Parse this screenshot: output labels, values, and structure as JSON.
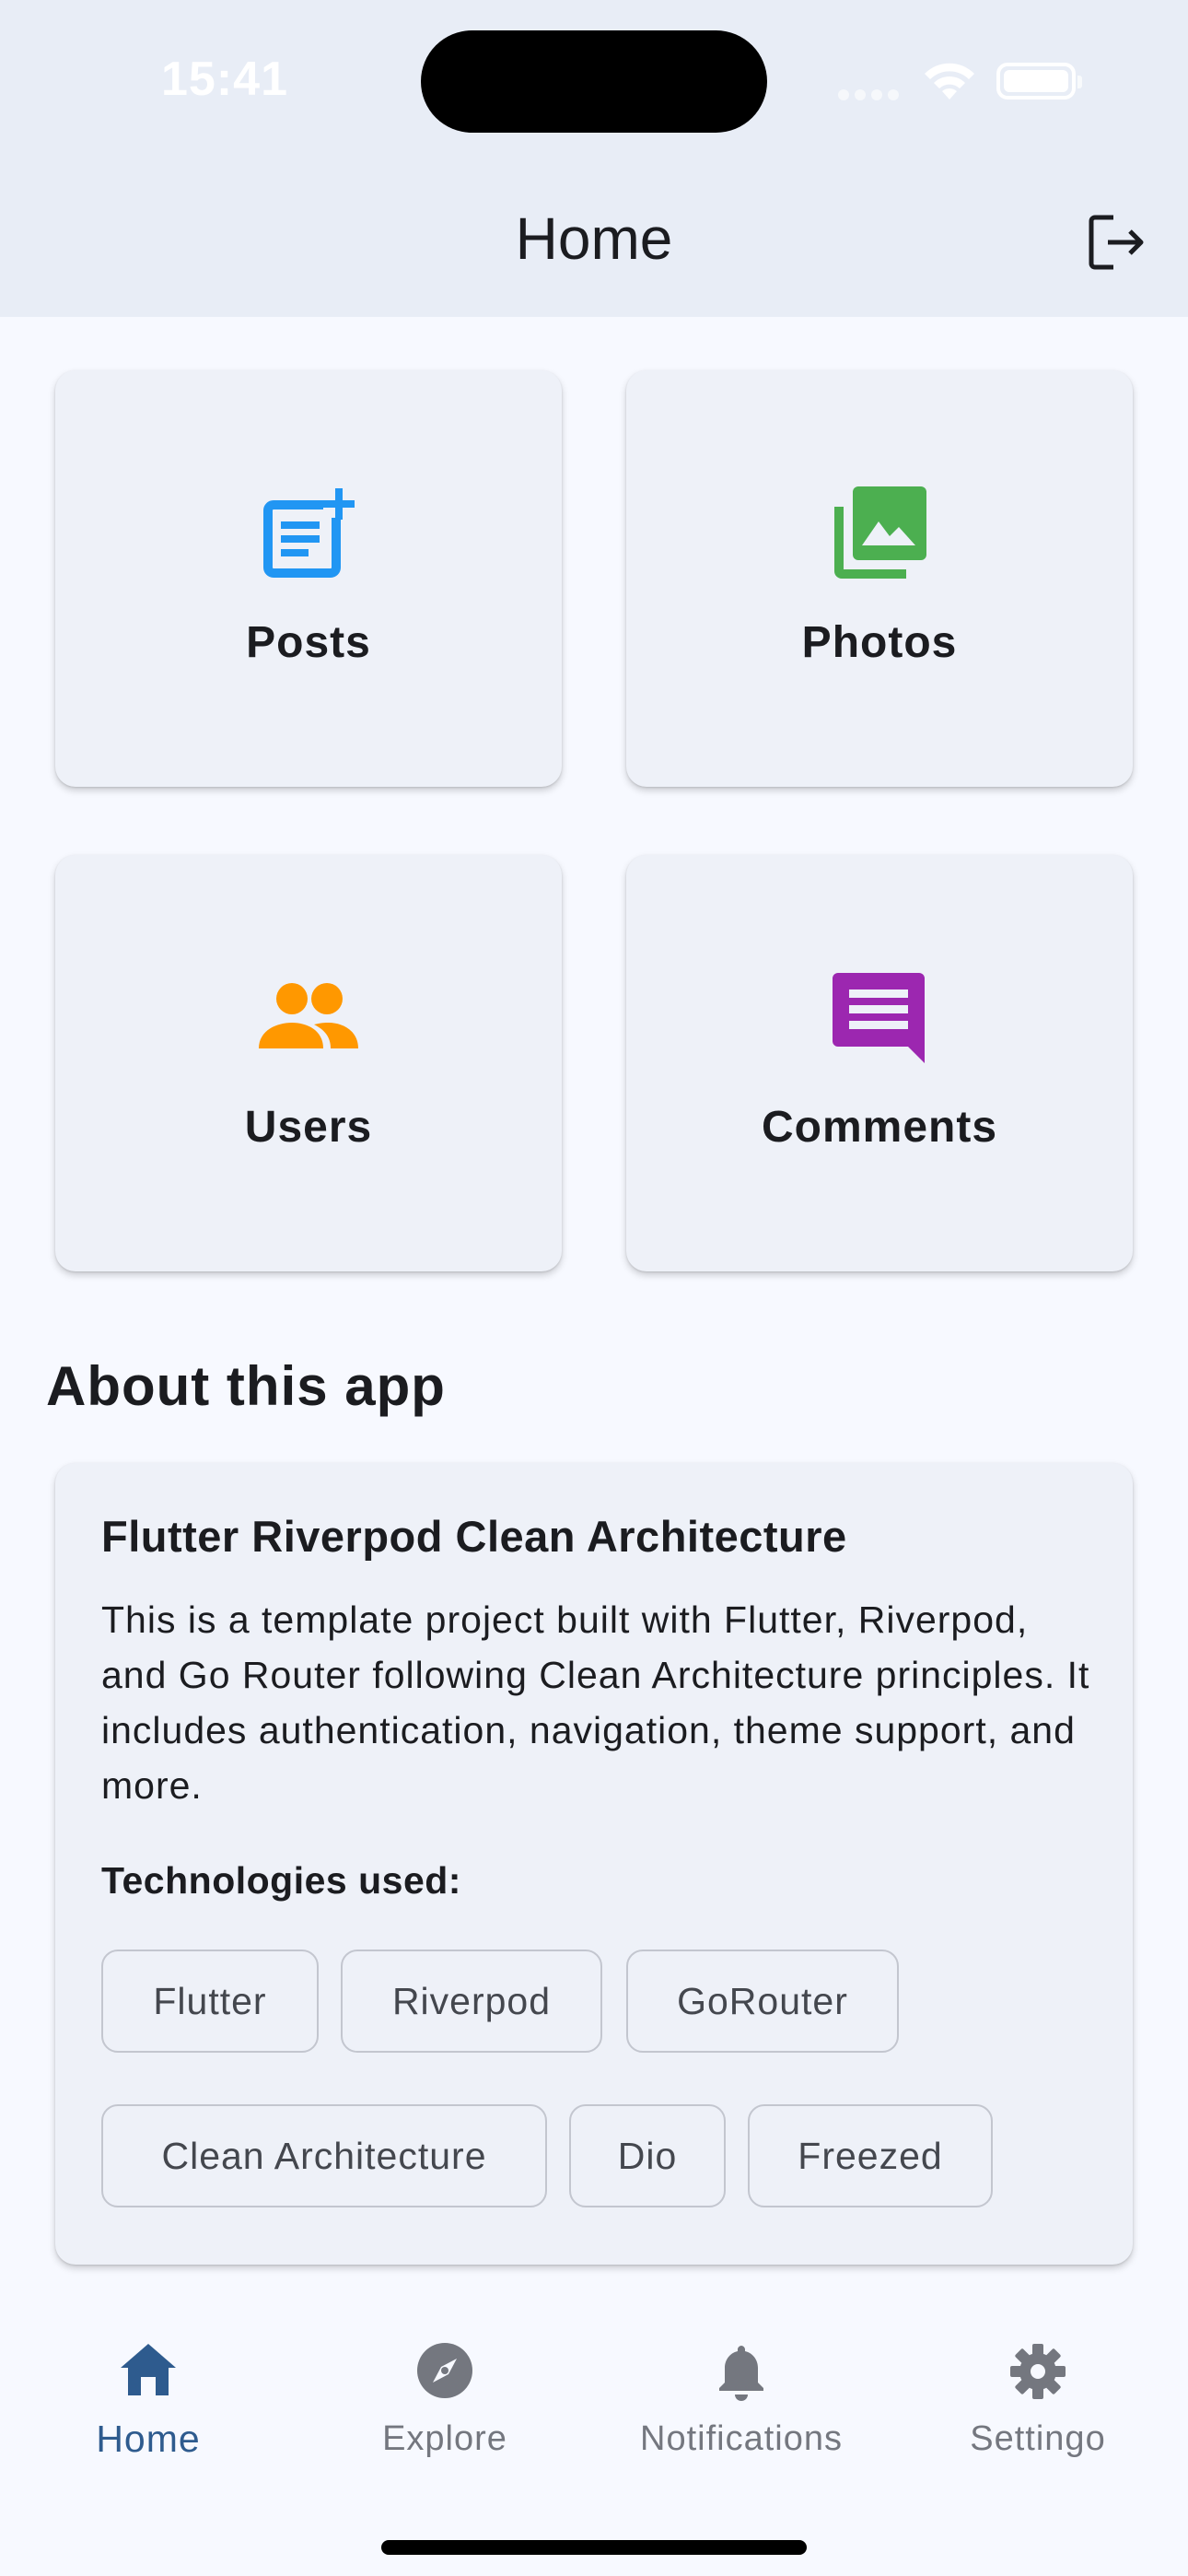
{
  "status_bar": {
    "time": "15:41",
    "icons": [
      "cellular-signal-icon",
      "wifi-icon",
      "battery-icon"
    ]
  },
  "app_bar": {
    "title": "Home",
    "action_icon": "logout-icon"
  },
  "grid": [
    {
      "label": "Posts",
      "icon": "post-add-icon",
      "color": "#2196f3"
    },
    {
      "label": "Photos",
      "icon": "photo-library-icon",
      "color": "#4caf50"
    },
    {
      "label": "Users",
      "icon": "people-icon",
      "color": "#ff9800"
    },
    {
      "label": "Comments",
      "icon": "comment-icon",
      "color": "#9c27b0"
    }
  ],
  "about": {
    "section_title": "About this app",
    "card_title": "Flutter Riverpod Clean Architecture",
    "description": "This is a template project built with Flutter, Riverpod, and Go Router following Clean Architecture principles. It includes authentication, navigation, theme support, and more.",
    "technologies_title": "Technologies used:",
    "technologies": [
      "Flutter",
      "Riverpod",
      "GoRouter",
      "Clean Architecture",
      "Dio",
      "Freezed"
    ]
  },
  "bottom_nav": {
    "items": [
      {
        "label": "Home",
        "icon": "home-icon",
        "active": true
      },
      {
        "label": "Explore",
        "icon": "explore-icon",
        "active": false
      },
      {
        "label": "Notifications",
        "icon": "bell-icon",
        "active": false
      },
      {
        "label": "Settingo",
        "icon": "gear-icon",
        "active": false
      }
    ]
  },
  "colors": {
    "primary": "#2e5b8e",
    "app_bar_bg": "#e8edf6",
    "page_bg": "#f7f9ff",
    "card_bg": "#eef1f8",
    "inactive": "#74777f"
  }
}
